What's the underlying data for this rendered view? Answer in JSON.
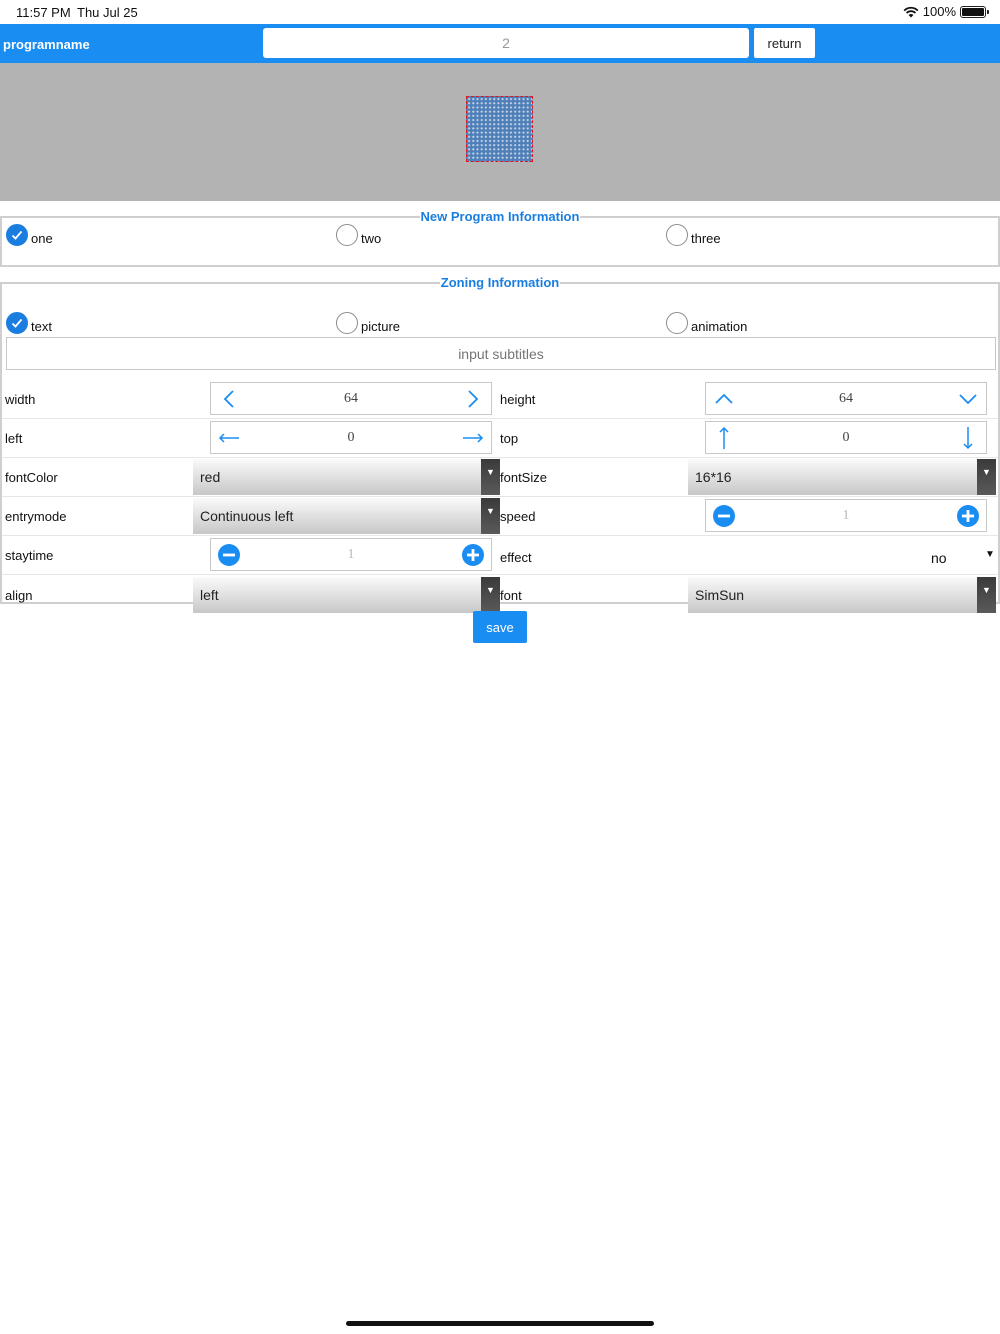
{
  "status": {
    "time": "11:57 PM",
    "date": "Thu Jul 25",
    "battery": "100%"
  },
  "nav": {
    "title": "programname",
    "program_name": "2",
    "return_label": "return"
  },
  "colors": {
    "accent": "#1a8df3",
    "led_border": "#e0161d",
    "led_fill": "#4f7fb8"
  },
  "program_info": {
    "legend": "New Program Information",
    "options": [
      {
        "label": "one",
        "checked": true
      },
      {
        "label": "two",
        "checked": false
      },
      {
        "label": "three",
        "checked": false
      }
    ]
  },
  "zoning_info": {
    "legend": "Zoning Information",
    "options": [
      {
        "label": "text",
        "checked": true
      },
      {
        "label": "picture",
        "checked": false
      },
      {
        "label": "animation",
        "checked": false
      }
    ],
    "subtitle_placeholder": "input subtitles",
    "width": {
      "label": "width",
      "value": "64"
    },
    "height": {
      "label": "height",
      "value": "64"
    },
    "left": {
      "label": "left",
      "value": "0"
    },
    "top": {
      "label": "top",
      "value": "0"
    },
    "fontColor": {
      "label": "fontColor",
      "value": "red"
    },
    "fontSize": {
      "label": "fontSize",
      "value": "16*16"
    },
    "entrymode": {
      "label": "entrymode",
      "value": "Continuous left"
    },
    "speed": {
      "label": "speed",
      "value": "1"
    },
    "staytime": {
      "label": "staytime",
      "value": "1"
    },
    "effect": {
      "label": "effect",
      "value": "no"
    },
    "align": {
      "label": "align",
      "value": "left"
    },
    "font": {
      "label": "font",
      "value": "SimSun"
    }
  },
  "save_label": "save"
}
